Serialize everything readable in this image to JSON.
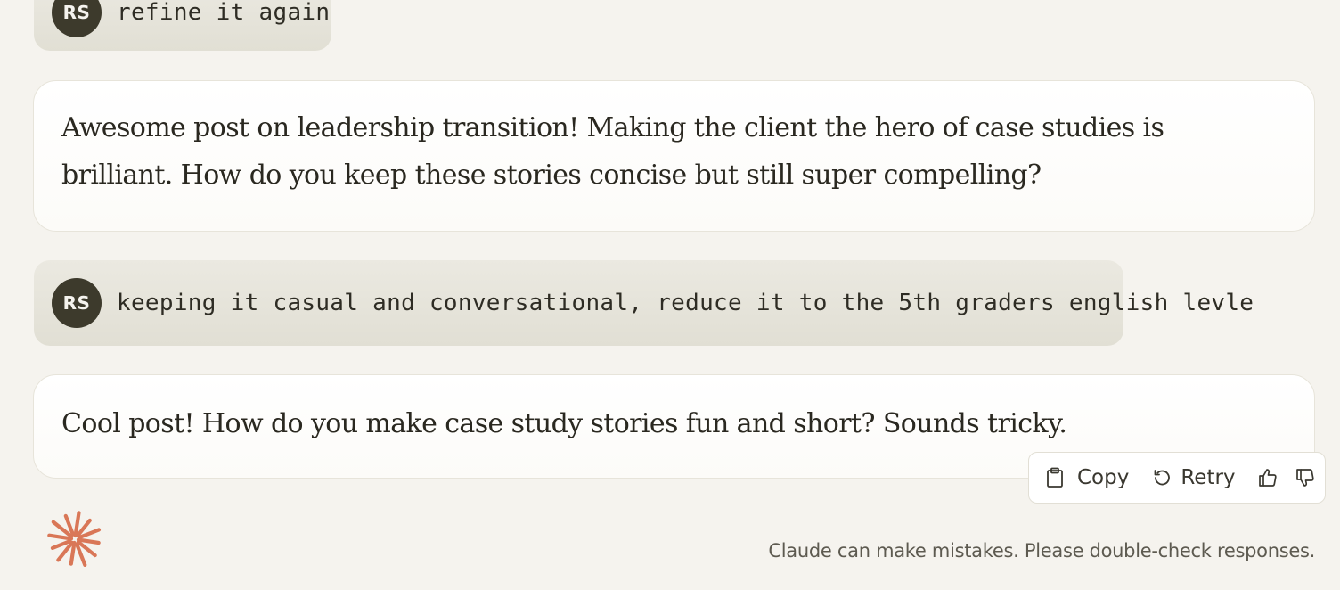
{
  "conversation": {
    "messages": [
      {
        "role": "user",
        "avatar": "RS",
        "text": "refine it again"
      },
      {
        "role": "assistant",
        "text": "Awesome post on leadership transition! Making the client the hero of case studies is brilliant. How do you keep these stories concise but still super compelling?"
      },
      {
        "role": "user",
        "avatar": "RS",
        "text": "keeping it casual and conversational, reduce it to the 5th graders english levle"
      },
      {
        "role": "assistant",
        "text": "Cool post! How do you make case study stories fun and short? Sounds tricky."
      }
    ]
  },
  "actions": {
    "copy_label": "Copy",
    "retry_label": "Retry",
    "icons": [
      "clipboard-icon",
      "retry-icon",
      "thumbs-up-icon",
      "thumbs-down-icon"
    ]
  },
  "footer": {
    "disclaimer": "Claude can make mistakes. Please double-check responses.",
    "logo_color": "#d97757"
  },
  "colors": {
    "background": "#f5f3ee",
    "user_bubble": "#e5e3d9",
    "avatar": "#3d3a2c"
  }
}
